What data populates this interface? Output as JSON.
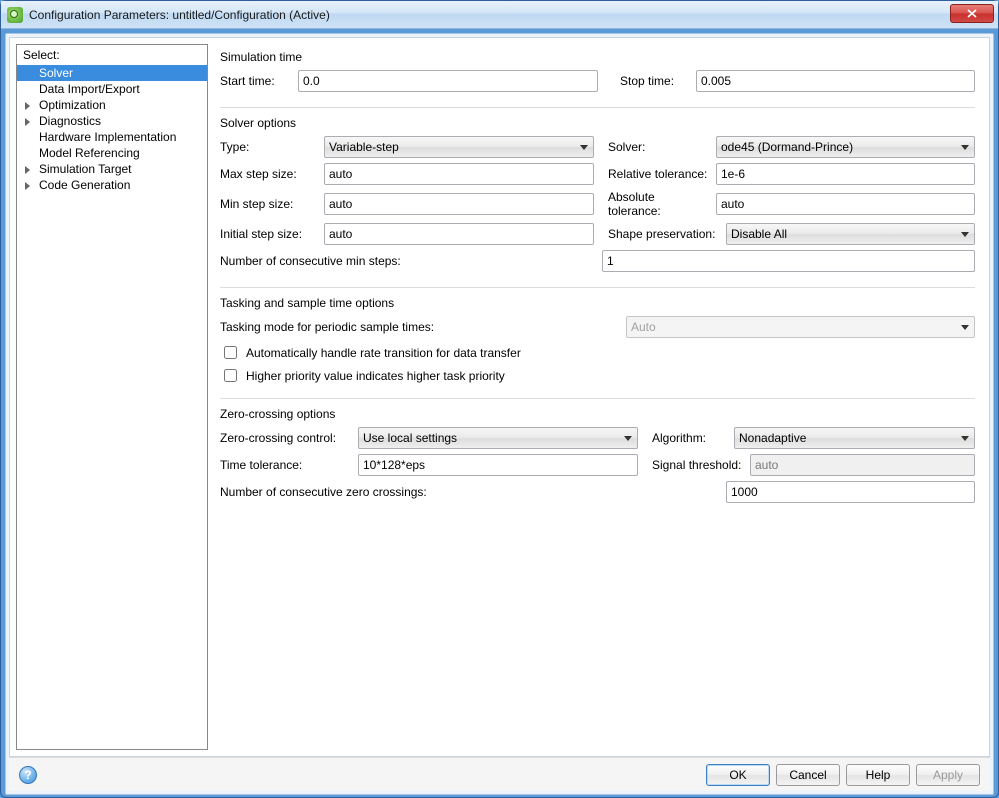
{
  "window": {
    "title": "Configuration Parameters: untitled/Configuration (Active)"
  },
  "sidebar": {
    "header": "Select:",
    "items": [
      {
        "label": "Solver",
        "selected": true,
        "expandable": false
      },
      {
        "label": "Data Import/Export",
        "selected": false,
        "expandable": false
      },
      {
        "label": "Optimization",
        "selected": false,
        "expandable": true
      },
      {
        "label": "Diagnostics",
        "selected": false,
        "expandable": true
      },
      {
        "label": "Hardware Implementation",
        "selected": false,
        "expandable": false
      },
      {
        "label": "Model Referencing",
        "selected": false,
        "expandable": false
      },
      {
        "label": "Simulation Target",
        "selected": false,
        "expandable": true
      },
      {
        "label": "Code Generation",
        "selected": false,
        "expandable": true
      }
    ]
  },
  "sim_time": {
    "title": "Simulation time",
    "start_label": "Start time:",
    "start_value": "0.0",
    "stop_label": "Stop time:",
    "stop_value": "0.005"
  },
  "solver_opts": {
    "title": "Solver options",
    "type_label": "Type:",
    "type_value": "Variable-step",
    "solver_label": "Solver:",
    "solver_value": "ode45 (Dormand-Prince)",
    "max_step_label": "Max step size:",
    "max_step_value": "auto",
    "rel_tol_label": "Relative tolerance:",
    "rel_tol_value": "1e-6",
    "min_step_label": "Min step size:",
    "min_step_value": "auto",
    "abs_tol_label": "Absolute tolerance:",
    "abs_tol_value": "auto",
    "init_step_label": "Initial step size:",
    "init_step_value": "auto",
    "shape_label": "Shape preservation:",
    "shape_value": "Disable All",
    "consec_min_label": "Number of consecutive min steps:",
    "consec_min_value": "1"
  },
  "tasking": {
    "title": "Tasking and sample time options",
    "mode_label": "Tasking mode for periodic sample times:",
    "mode_value": "Auto",
    "chk_auto_rate": "Automatically handle rate transition for data transfer",
    "chk_priority": "Higher priority value indicates higher task priority"
  },
  "zero": {
    "title": "Zero-crossing options",
    "control_label": "Zero-crossing control:",
    "control_value": "Use local settings",
    "algo_label": "Algorithm:",
    "algo_value": "Nonadaptive",
    "time_tol_label": "Time tolerance:",
    "time_tol_value": "10*128*eps",
    "sig_thresh_label": "Signal threshold:",
    "sig_thresh_value": "auto",
    "consec_label": "Number of consecutive zero crossings:",
    "consec_value": "1000"
  },
  "buttons": {
    "ok": "OK",
    "cancel": "Cancel",
    "help": "Help",
    "apply": "Apply"
  }
}
